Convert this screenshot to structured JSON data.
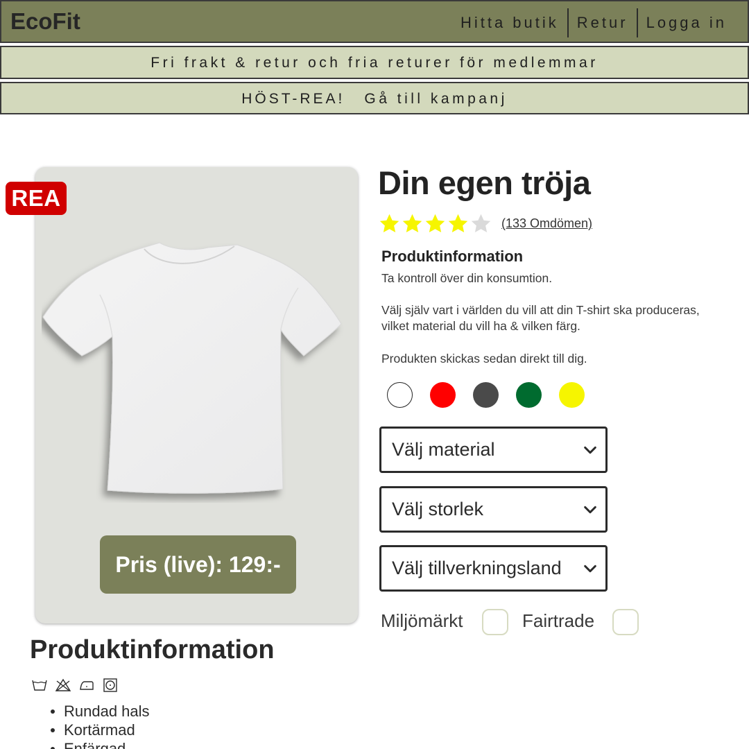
{
  "header": {
    "logo": "EcoFit",
    "nav": [
      "Hitta butik",
      "Retur",
      "Logga in"
    ]
  },
  "banners": {
    "shipping": "Fri frakt & retur och fria returer för medlemmar",
    "sale_label": "HÖST-REA!",
    "sale_link": "Gå till kampanj"
  },
  "product": {
    "badge": "REA",
    "price": "Pris (live): 129:-",
    "title": "Din egen tröja",
    "rating": 4,
    "rating_max": 5,
    "reviews": "(133 Omdömen)",
    "info_heading": "Produktinformation",
    "info_1": "Ta kontroll över din konsumtion.",
    "info_2": "Välj själv vart i världen du vill att din T-shirt ska produceras, vilket material du vill ha & vilken färg.",
    "info_3": "Produkten skickas sedan direkt till dig.",
    "colors": [
      "#ffffff",
      "#ff0000",
      "#4a4a4a",
      "#006b2f",
      "#f6f500"
    ],
    "select_material": "Välj material",
    "select_size": "Välj storlek",
    "select_country": "Välj tillverkningsland",
    "check_eco": "Miljömärkt",
    "check_fairtrade": "Fairtrade"
  },
  "details": {
    "heading": "Produktinformation",
    "care_icons": [
      "wash-icon",
      "no-bleach-icon",
      "iron-icon",
      "tumble-dry-icon"
    ],
    "features": [
      "Rundad hals",
      "Kortärmad",
      "Enfärgad"
    ]
  },
  "colors": {
    "header_bg": "#7b8059",
    "banner_bg": "#d3d9bc",
    "sale_badge": "#d00000",
    "star_active": "#f6f500",
    "star_inactive": "#dadada"
  }
}
